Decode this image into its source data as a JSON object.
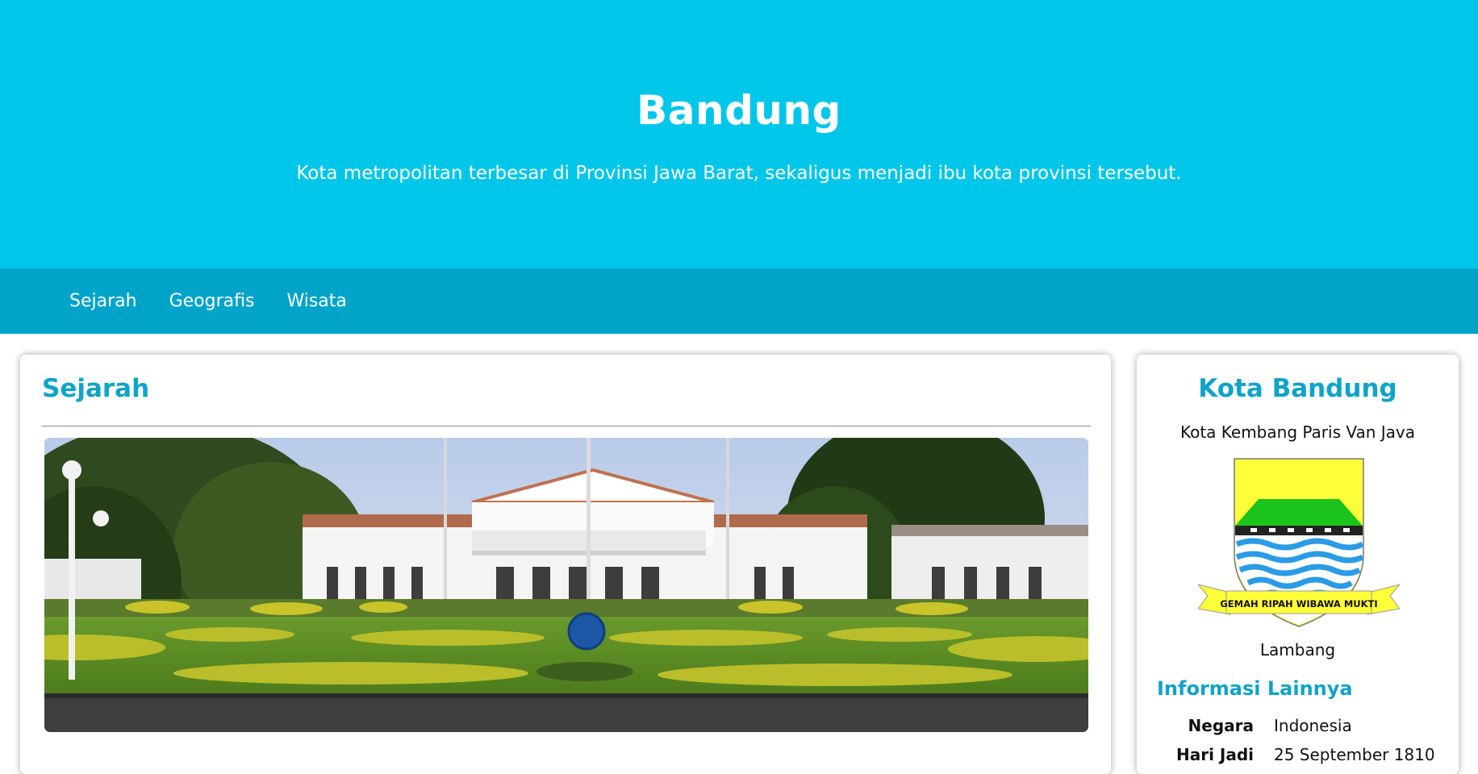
{
  "header": {
    "title": "Bandung",
    "subtitle": "Kota metropolitan terbesar di Provinsi Jawa Barat, sekaligus menjadi ibu kota provinsi tersebut."
  },
  "nav": {
    "items": [
      {
        "label": "Sejarah"
      },
      {
        "label": "Geografis"
      },
      {
        "label": "Wisata"
      }
    ]
  },
  "content": {
    "title": "Sejarah",
    "image": "gedung-sate-photo"
  },
  "sidebar": {
    "title": "Kota Bandung",
    "subtitle": "Kota Kembang Paris Van Java",
    "emblem_motto": "GEMAH RIPAH WIBAWA MUKTI",
    "emblem_caption": "Lambang",
    "info_title": "Informasi Lainnya",
    "info": [
      {
        "key": "Negara",
        "value": "Indonesia"
      },
      {
        "key": "Hari Jadi",
        "value": "25 September 1810"
      }
    ]
  },
  "colors": {
    "header_bg": "#00c6ea",
    "nav_bg": "#00a4c8",
    "accent": "#10a3c8"
  }
}
